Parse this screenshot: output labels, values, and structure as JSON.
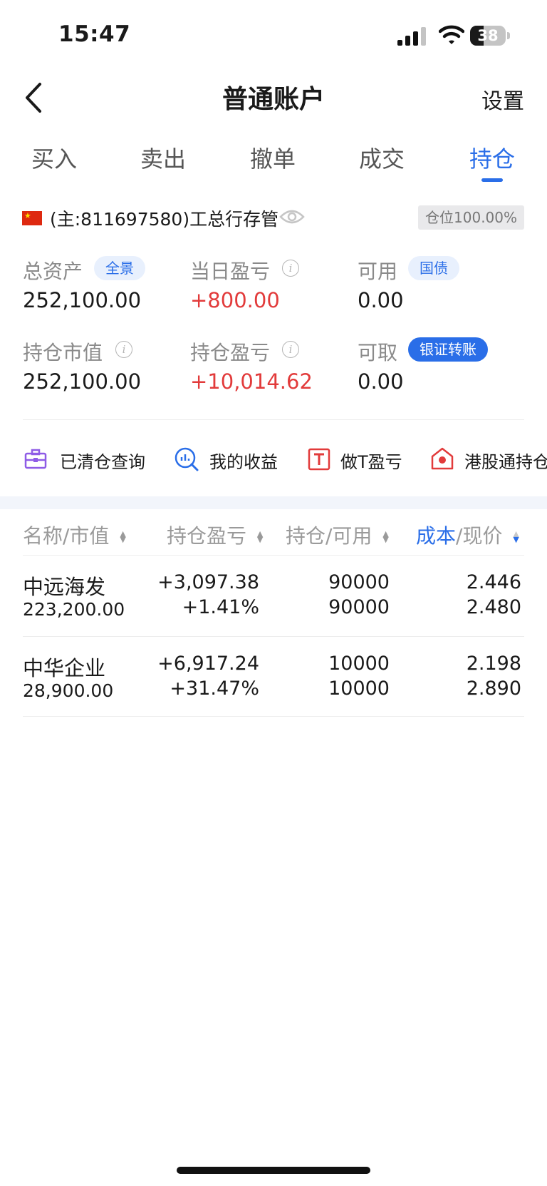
{
  "status_bar": {
    "time": "15:47",
    "battery": "38",
    "battery_level": 0.38
  },
  "nav": {
    "title": "普通账户",
    "settings": "设置"
  },
  "tabs": [
    {
      "label": "买入",
      "active": false
    },
    {
      "label": "卖出",
      "active": false
    },
    {
      "label": "撤单",
      "active": false
    },
    {
      "label": "成交",
      "active": false
    },
    {
      "label": "持仓",
      "active": true
    }
  ],
  "account": {
    "name": "(主:811697580)工总行存管",
    "position_badge": "仓位100.00%"
  },
  "stats": {
    "total_assets": {
      "label": "总资产",
      "value": "252,100.00",
      "tag": "全景"
    },
    "daily_pl": {
      "label": "当日盈亏",
      "value": "+800.00"
    },
    "available": {
      "label": "可用",
      "value": "0.00",
      "tag": "国债"
    },
    "market_value": {
      "label": "持仓市值",
      "value": "252,100.00"
    },
    "position_pl": {
      "label": "持仓盈亏",
      "value": "+10,014.62"
    },
    "withdrawable": {
      "label": "可取",
      "value": "0.00",
      "tag": "银证转账"
    }
  },
  "shortcuts": [
    {
      "label": "已清仓查询",
      "icon": "briefcase-icon"
    },
    {
      "label": "我的收益",
      "icon": "chart-magnifier-icon"
    },
    {
      "label": "做T盈亏",
      "icon": "t-box-icon"
    },
    {
      "label": "港股通持仓",
      "icon": "hk-house-icon"
    }
  ],
  "table": {
    "headers": [
      "名称/市值",
      "持仓盈亏",
      "持仓/可用",
      "成本/现价"
    ],
    "header_sub": [
      "成本",
      "/现价"
    ],
    "rows": [
      {
        "name": "中远海发",
        "market_value": "223,200.00",
        "pl": "+3,097.38",
        "pl_pct": "+1.41%",
        "hold": "90000",
        "avail": "90000",
        "cost": "2.446",
        "price": "2.480"
      },
      {
        "name": "中华企业",
        "market_value": "28,900.00",
        "pl": "+6,917.24",
        "pl_pct": "+31.47%",
        "hold": "10000",
        "avail": "10000",
        "cost": "2.198",
        "price": "2.890"
      }
    ]
  },
  "colors": {
    "accent": "#2a6ee8",
    "gain": "#e23b3b",
    "muted": "#8a8a8a"
  }
}
